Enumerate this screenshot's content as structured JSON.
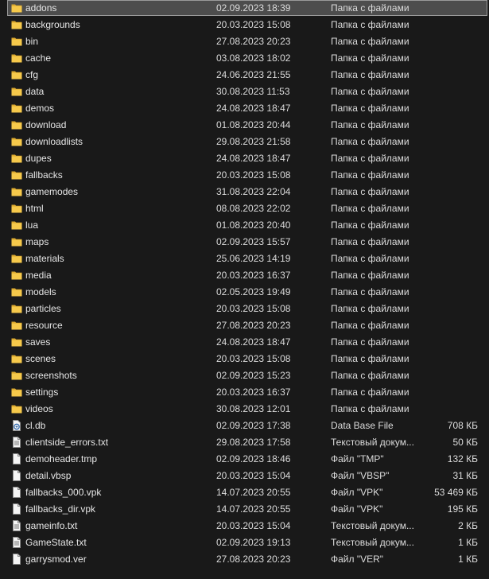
{
  "rows": [
    {
      "name": "addons",
      "date": "02.09.2023 18:39",
      "type": "Папка с файлами",
      "size": "",
      "icon": "folder-icon",
      "selected": true
    },
    {
      "name": "backgrounds",
      "date": "20.03.2023 15:08",
      "type": "Папка с файлами",
      "size": "",
      "icon": "folder-icon"
    },
    {
      "name": "bin",
      "date": "27.08.2023 20:23",
      "type": "Папка с файлами",
      "size": "",
      "icon": "folder-icon"
    },
    {
      "name": "cache",
      "date": "03.08.2023 18:02",
      "type": "Папка с файлами",
      "size": "",
      "icon": "folder-icon"
    },
    {
      "name": "cfg",
      "date": "24.06.2023 21:55",
      "type": "Папка с файлами",
      "size": "",
      "icon": "folder-icon"
    },
    {
      "name": "data",
      "date": "30.08.2023 11:53",
      "type": "Папка с файлами",
      "size": "",
      "icon": "folder-icon"
    },
    {
      "name": "demos",
      "date": "24.08.2023 18:47",
      "type": "Папка с файлами",
      "size": "",
      "icon": "folder-icon"
    },
    {
      "name": "download",
      "date": "01.08.2023 20:44",
      "type": "Папка с файлами",
      "size": "",
      "icon": "folder-icon"
    },
    {
      "name": "downloadlists",
      "date": "29.08.2023 21:58",
      "type": "Папка с файлами",
      "size": "",
      "icon": "folder-icon"
    },
    {
      "name": "dupes",
      "date": "24.08.2023 18:47",
      "type": "Папка с файлами",
      "size": "",
      "icon": "folder-icon"
    },
    {
      "name": "fallbacks",
      "date": "20.03.2023 15:08",
      "type": "Папка с файлами",
      "size": "",
      "icon": "folder-icon"
    },
    {
      "name": "gamemodes",
      "date": "31.08.2023 22:04",
      "type": "Папка с файлами",
      "size": "",
      "icon": "folder-icon"
    },
    {
      "name": "html",
      "date": "08.08.2023 22:02",
      "type": "Папка с файлами",
      "size": "",
      "icon": "folder-icon"
    },
    {
      "name": "lua",
      "date": "01.08.2023 20:40",
      "type": "Папка с файлами",
      "size": "",
      "icon": "folder-icon"
    },
    {
      "name": "maps",
      "date": "02.09.2023 15:57",
      "type": "Папка с файлами",
      "size": "",
      "icon": "folder-icon"
    },
    {
      "name": "materials",
      "date": "25.06.2023 14:19",
      "type": "Папка с файлами",
      "size": "",
      "icon": "folder-icon"
    },
    {
      "name": "media",
      "date": "20.03.2023 16:37",
      "type": "Папка с файлами",
      "size": "",
      "icon": "folder-icon"
    },
    {
      "name": "models",
      "date": "02.05.2023 19:49",
      "type": "Папка с файлами",
      "size": "",
      "icon": "folder-icon"
    },
    {
      "name": "particles",
      "date": "20.03.2023 15:08",
      "type": "Папка с файлами",
      "size": "",
      "icon": "folder-icon"
    },
    {
      "name": "resource",
      "date": "27.08.2023 20:23",
      "type": "Папка с файлами",
      "size": "",
      "icon": "folder-icon"
    },
    {
      "name": "saves",
      "date": "24.08.2023 18:47",
      "type": "Папка с файлами",
      "size": "",
      "icon": "folder-icon"
    },
    {
      "name": "scenes",
      "date": "20.03.2023 15:08",
      "type": "Папка с файлами",
      "size": "",
      "icon": "folder-icon"
    },
    {
      "name": "screenshots",
      "date": "02.09.2023 15:23",
      "type": "Папка с файлами",
      "size": "",
      "icon": "folder-icon"
    },
    {
      "name": "settings",
      "date": "20.03.2023 16:37",
      "type": "Папка с файлами",
      "size": "",
      "icon": "folder-icon"
    },
    {
      "name": "videos",
      "date": "30.08.2023 12:01",
      "type": "Папка с файлами",
      "size": "",
      "icon": "folder-icon"
    },
    {
      "name": "cl.db",
      "date": "02.09.2023 17:38",
      "type": "Data Base File",
      "size": "708 КБ",
      "icon": "database-file-icon"
    },
    {
      "name": "clientside_errors.txt",
      "date": "29.08.2023 17:58",
      "type": "Текстовый докум...",
      "size": "50 КБ",
      "icon": "text-file-icon"
    },
    {
      "name": "demoheader.tmp",
      "date": "02.09.2023 18:46",
      "type": "Файл \"TMP\"",
      "size": "132 КБ",
      "icon": "file-icon"
    },
    {
      "name": "detail.vbsp",
      "date": "20.03.2023 15:04",
      "type": "Файл \"VBSP\"",
      "size": "31 КБ",
      "icon": "file-icon"
    },
    {
      "name": "fallbacks_000.vpk",
      "date": "14.07.2023 20:55",
      "type": "Файл \"VPK\"",
      "size": "53 469 КБ",
      "icon": "file-icon"
    },
    {
      "name": "fallbacks_dir.vpk",
      "date": "14.07.2023 20:55",
      "type": "Файл \"VPK\"",
      "size": "195 КБ",
      "icon": "file-icon"
    },
    {
      "name": "gameinfo.txt",
      "date": "20.03.2023 15:04",
      "type": "Текстовый докум...",
      "size": "2 КБ",
      "icon": "text-file-icon"
    },
    {
      "name": "GameState.txt",
      "date": "02.09.2023 19:13",
      "type": "Текстовый докум...",
      "size": "1 КБ",
      "icon": "text-file-icon"
    },
    {
      "name": "garrysmod.ver",
      "date": "27.08.2023 20:23",
      "type": "Файл \"VER\"",
      "size": "1 КБ",
      "icon": "file-icon"
    }
  ],
  "colors": {
    "background": "#191919",
    "selection_fill": "#4d4d4d",
    "selection_border": "#9a9a9a",
    "folder": "#e8b93c",
    "text": "#e6e6e6"
  }
}
